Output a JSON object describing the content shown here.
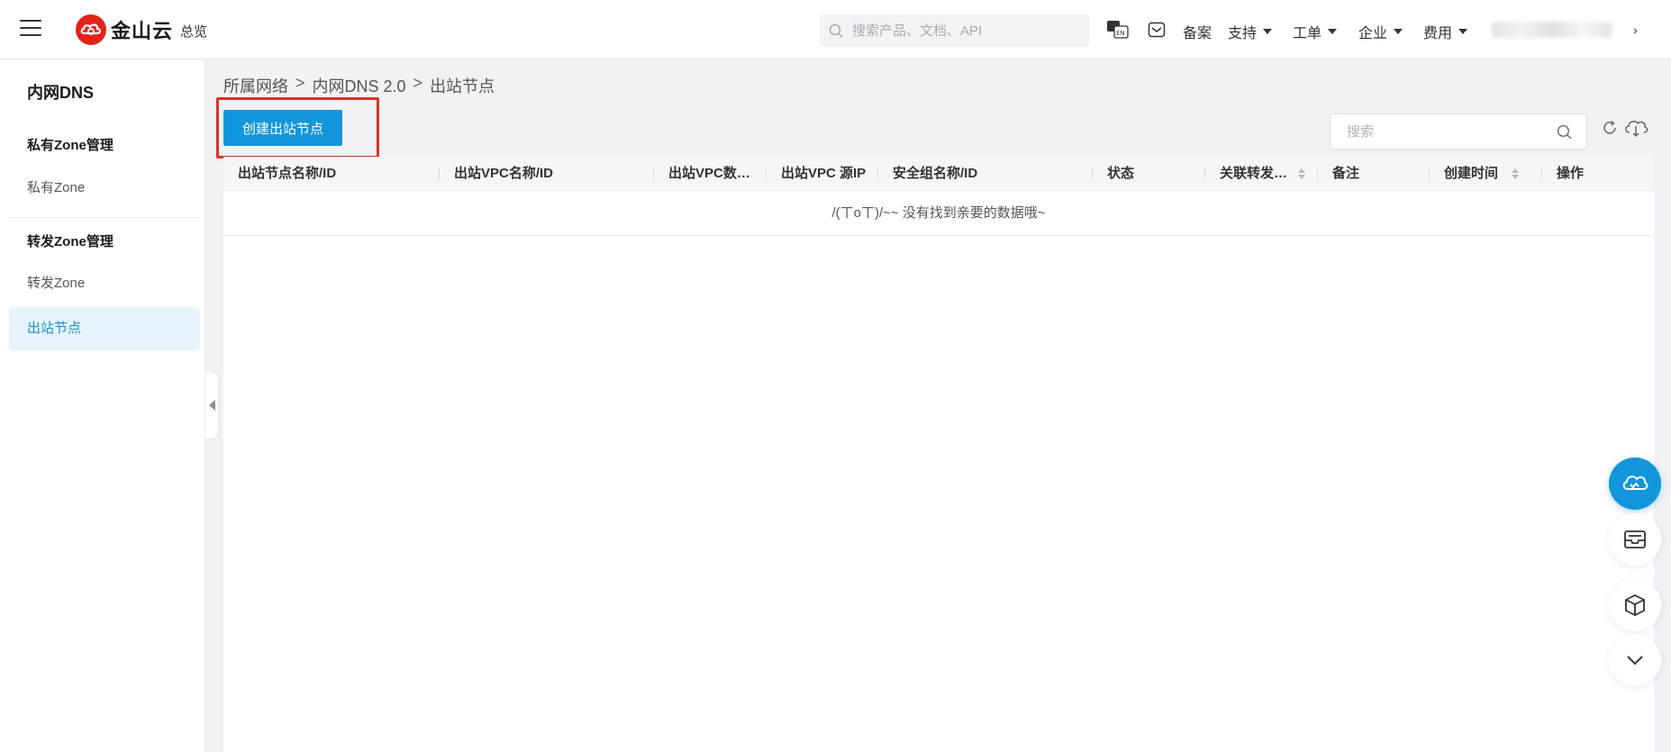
{
  "header": {
    "logo_text": "金山云",
    "overview": "总览",
    "search_placeholder": "搜索产品、文档、API",
    "nav": {
      "beian": "备案",
      "support": "支持",
      "ticket": "工单",
      "enterprise": "企业",
      "billing": "费用"
    },
    "user_arrow": "›"
  },
  "sidebar": {
    "title": "内网DNS",
    "groups": [
      {
        "label": "私有Zone管理",
        "items": [
          "私有Zone"
        ]
      },
      {
        "label": "转发Zone管理",
        "items": [
          "转发Zone",
          "出站节点"
        ]
      }
    ],
    "active": "出站节点"
  },
  "breadcrumb": {
    "items": [
      "所属网络",
      "内网DNS 2.0",
      "出站节点"
    ],
    "separator": ">"
  },
  "toolbar": {
    "create_label": "创建出站节点",
    "search_placeholder": "搜索"
  },
  "table": {
    "columns": [
      "出站节点名称/ID",
      "出站VPC名称/ID",
      "出站VPC数…",
      "出站VPC 源IP",
      "安全组名称/ID",
      "状态",
      "关联转发…",
      "备注",
      "创建时间",
      "操作"
    ],
    "empty_text": "/(ㄒoㄒ)/~~ 没有找到亲要的数据哦~"
  },
  "colors": {
    "accent": "#1296db",
    "brand_red": "#e2231a",
    "highlight": "#d9342b",
    "active_bg": "#e8f4fd"
  }
}
